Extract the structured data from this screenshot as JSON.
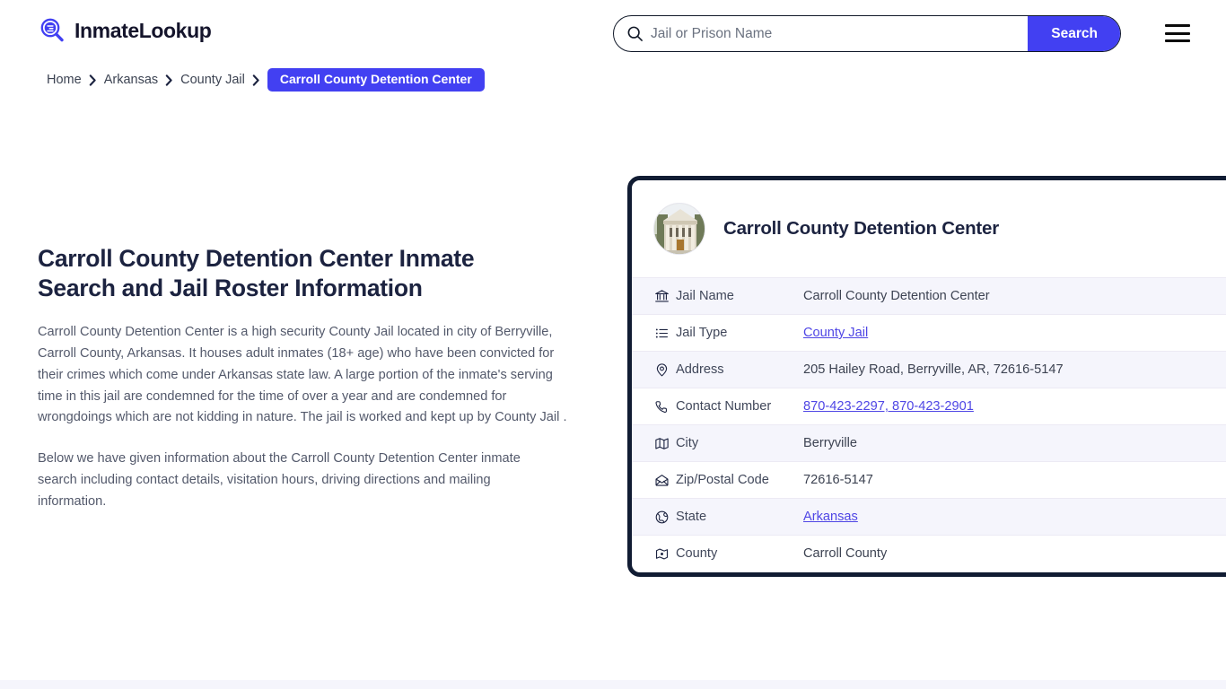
{
  "brand": {
    "name": "InmateLookup",
    "logo_icon": "magnifier-list-icon",
    "accent_color": "#4240f2"
  },
  "search": {
    "placeholder": "Jail or Prison Name",
    "value": "",
    "button_label": "Search",
    "icon": "search-icon"
  },
  "menu": {
    "icon": "hamburger-icon"
  },
  "breadcrumb": {
    "items": [
      {
        "label": "Home",
        "current": false
      },
      {
        "label": "Arkansas",
        "current": false
      },
      {
        "label": "County Jail",
        "current": false
      },
      {
        "label": "Carroll County Detention Center",
        "current": true
      }
    ],
    "separator_icon": "chevron-right-icon"
  },
  "main": {
    "title": "Carroll County Detention Center Inmate Search and Jail Roster Information",
    "paragraph_1": "Carroll County Detention Center is a high security County Jail located in city of Berryville, Carroll County, Arkansas. It houses adult inmates (18+ age) who have been convicted for their crimes which come under Arkansas state law. A large portion of the inmate's serving time in this jail are condemned for the time of over a year and are condemned for wrongdoings which are not kidding in nature. The jail is worked and kept up by County Jail .",
    "paragraph_2": "Below we have given information about the Carroll County Detention Center inmate search including contact details, visitation hours, driving directions and mailing information."
  },
  "info_card": {
    "title": "Carroll County Detention Center",
    "thumbnail_icon": "courthouse-photo",
    "rows": [
      {
        "icon": "bank-icon",
        "label": "Jail Name",
        "value": "Carroll County Detention Center",
        "link": false
      },
      {
        "icon": "list-icon",
        "label": "Jail Type",
        "value": "County Jail",
        "link": true
      },
      {
        "icon": "map-pin-icon",
        "label": "Address",
        "value": "205 Hailey Road, Berryville, AR, 72616-5147",
        "link": false
      },
      {
        "icon": "phone-icon",
        "label": "Contact Number",
        "value": "870-423-2297, 870-423-2901",
        "link": true
      },
      {
        "icon": "map-icon",
        "label": "City",
        "value": "Berryville",
        "link": false
      },
      {
        "icon": "envelope-icon",
        "label": "Zip/Postal Code",
        "value": "72616-5147",
        "link": false
      },
      {
        "icon": "globe-icon",
        "label": "State",
        "value": "Arkansas",
        "link": true
      },
      {
        "icon": "county-icon",
        "label": "County",
        "value": "Carroll County",
        "link": false
      }
    ]
  }
}
